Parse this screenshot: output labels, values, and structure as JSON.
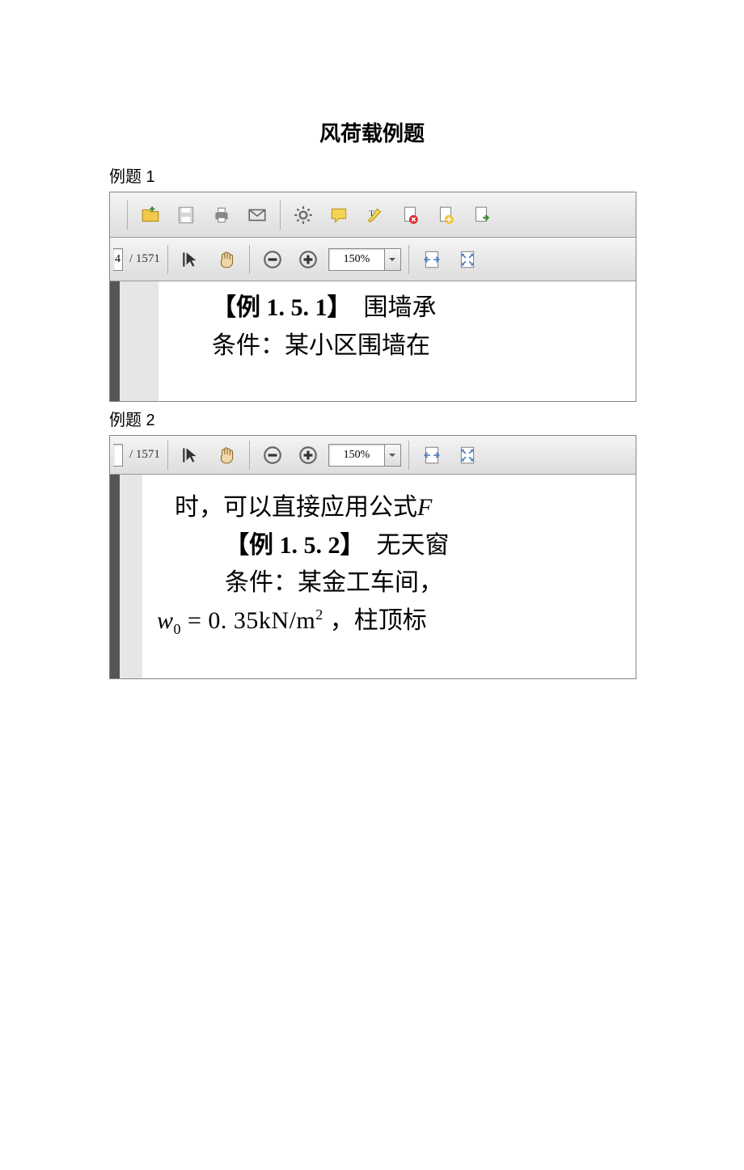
{
  "page_title": "风荷载例题",
  "example1": {
    "label": "例题 1",
    "page_current_fragment": "4",
    "page_total": "/ 1571",
    "zoom": "150%",
    "doc": {
      "line1_bold": "【例 1. 5. 1】",
      "line1_rest": "　围墙承",
      "line2": "条件：某小区围墙在"
    }
  },
  "example2": {
    "label": "例题 2",
    "page_total": "/ 1571",
    "zoom": "150%",
    "doc": {
      "line1": "时，可以直接应用公式",
      "line1_ital": "F",
      "line2_bold": "【例 1. 5. 2】",
      "line2_rest": "　无天窗",
      "line3": "条件：某金工车间，",
      "line4_eq_var": "w",
      "line4_eq_sub": "0",
      "line4_eq_rest": " = 0. 35kN/m",
      "line4_eq_sup": "2",
      "line4_tail": "，柱顶标"
    }
  }
}
